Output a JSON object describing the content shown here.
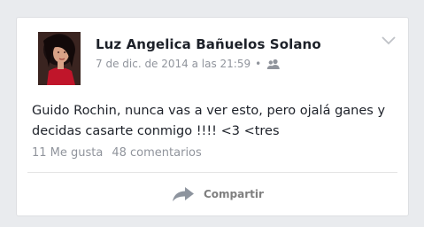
{
  "post": {
    "author_name": "Luz Angelica Bañuelos Solano",
    "timestamp": "7 de dic. de 2014 a las 21:59",
    "separator": "•",
    "privacy_icon": "friends-icon",
    "body_text": "Guido Rochin, nunca vas a ver esto, pero ojalá ganes y decidas casarte conmigo !!!! <3 <tres",
    "likes_label": "11 Me gusta",
    "comments_label": "48 comentarios",
    "share_label": "Compartir"
  },
  "icons": {
    "menu": "chevron-down-icon",
    "share": "share-arrow-icon"
  },
  "colors": {
    "background": "#e9ebee",
    "card": "#ffffff",
    "text_primary": "#1d2129",
    "text_secondary": "#90949c"
  }
}
